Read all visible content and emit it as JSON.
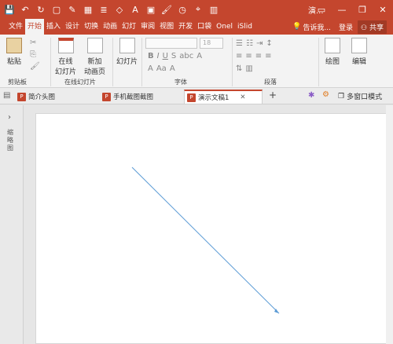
{
  "title": "演...",
  "tabs": [
    "文件",
    "开始",
    "插入",
    "设计",
    "切换",
    "动画",
    "幻灯",
    "审阅",
    "视图",
    "开发",
    "口袋",
    "Onel",
    "iSlid"
  ],
  "tell_me": "告诉我...",
  "login": "登录",
  "share": "共享",
  "ribbon": {
    "paste": "粘贴",
    "online_slide": "在线\n幻灯片",
    "new_slide": "新加\n动画页",
    "slides": "幻灯片",
    "font_size": "18",
    "draw": "绘图",
    "edit": "编辑",
    "groups": {
      "clipboard": "剪贴板",
      "online": "在线幻灯片",
      "font": "字体",
      "paragraph": "段落"
    }
  },
  "doc_tabs": [
    "简介头图",
    "手机截图截图",
    "演示文稿1"
  ],
  "multi_window": "多窗口模式",
  "side_label": "缩略图",
  "chart_data": null
}
